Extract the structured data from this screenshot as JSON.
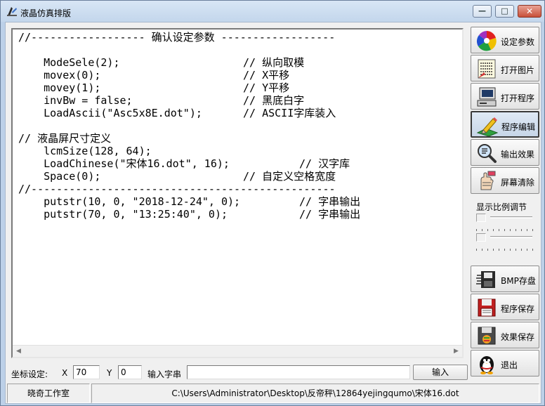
{
  "window": {
    "title": "液晶仿真排版",
    "min_glyph": "—",
    "max_glyph": "□",
    "close_glyph": "✕"
  },
  "editor": {
    "lines": [
      {
        "a": "//------------------ 确认设定参数 ------------------",
        "b": ""
      },
      {
        "a": "",
        "b": ""
      },
      {
        "a": "    ModeSele(2);",
        "b": "// 纵向取模"
      },
      {
        "a": "    movex(0);",
        "b": "// X平移"
      },
      {
        "a": "    movey(1);",
        "b": "// Y平移"
      },
      {
        "a": "    invBw = false;",
        "b": "// 黑底白字"
      },
      {
        "a": "    LoadAscii(\"Asc5x8E.dot\");",
        "b": "// ASCII字库装入"
      },
      {
        "a": "",
        "b": ""
      },
      {
        "a": "// 液晶屏尺寸定义",
        "b": ""
      },
      {
        "a": "    lcmSize(128, 64);",
        "b": ""
      },
      {
        "a": "    LoadChinese(\"宋体16.dot\", 16);",
        "b": "// 汉字库"
      },
      {
        "a": "    Space(0);",
        "b": "// 自定义空格宽度"
      },
      {
        "a": "//------------------------------------------------",
        "b": ""
      },
      {
        "a": "    putstr(10, 0, \"2018-12-24\", 0);",
        "b": "// 字串输出"
      },
      {
        "a": "    putstr(70, 0, \"13:25:40\", 0);",
        "b": "// 字串输出"
      }
    ],
    "scroll_left": "◀",
    "scroll_right": "▶"
  },
  "sidebar": {
    "buttons": [
      {
        "label": "设定参数",
        "icon": "color-wheel-icon"
      },
      {
        "label": "打开图片",
        "icon": "binary-image-icon"
      },
      {
        "label": "打开程序",
        "icon": "computer-icon"
      },
      {
        "label": "程序编辑",
        "icon": "edit-pencil-icon"
      },
      {
        "label": "输出效果",
        "icon": "magnifier-icon"
      },
      {
        "label": "屏幕清除",
        "icon": "eraser-hand-icon"
      }
    ],
    "zoom_title": "显示比例调节",
    "buttons2": [
      {
        "label": "BMP存盘",
        "icon": "bmp-save-icon"
      },
      {
        "label": "程序保存",
        "icon": "floppy-icon"
      },
      {
        "label": "效果保存",
        "icon": "apple-floppy-icon"
      },
      {
        "label": "退出",
        "icon": "penguin-icon"
      }
    ]
  },
  "coords": {
    "label": "坐标设定:",
    "x_label": "X",
    "x_value": "70",
    "y_label": "Y",
    "y_value": "0",
    "input_label": "输入字串",
    "input_value": "",
    "input_button": "输入"
  },
  "status": {
    "studio": "晓奇工作室",
    "path": "C:\\Users\\Administrator\\Desktop\\反帝秤\\12864yejingqumo\\宋体16.dot"
  }
}
